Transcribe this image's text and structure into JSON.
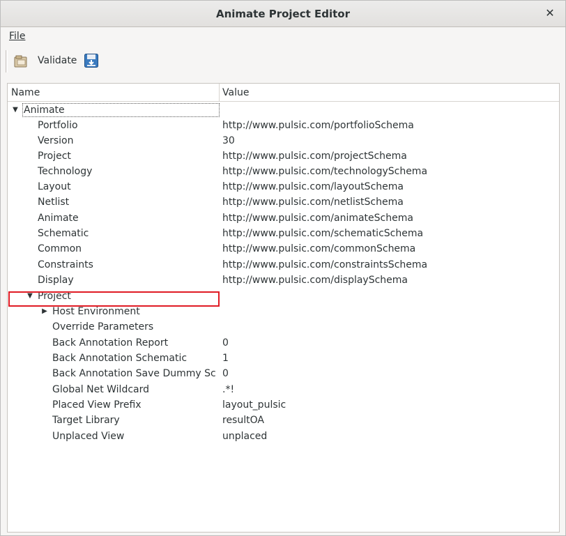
{
  "window": {
    "title": "Animate Project Editor"
  },
  "menu": {
    "file_label": "File"
  },
  "toolbar": {
    "validate_label": "Validate"
  },
  "tree": {
    "columns": {
      "name": "Name",
      "value": "Value"
    },
    "root": {
      "name": "Animate",
      "expanded": true
    },
    "schema_rows": [
      {
        "name": "Portfolio",
        "value": "http://www.pulsic.com/portfolioSchema"
      },
      {
        "name": "Version",
        "value": "30"
      },
      {
        "name": "Project",
        "value": "http://www.pulsic.com/projectSchema"
      },
      {
        "name": "Technology",
        "value": "http://www.pulsic.com/technologySchema"
      },
      {
        "name": "Layout",
        "value": "http://www.pulsic.com/layoutSchema"
      },
      {
        "name": "Netlist",
        "value": "http://www.pulsic.com/netlistSchema"
      },
      {
        "name": "Animate",
        "value": "http://www.pulsic.com/animateSchema"
      },
      {
        "name": "Schematic",
        "value": "http://www.pulsic.com/schematicSchema"
      },
      {
        "name": "Common",
        "value": "http://www.pulsic.com/commonSchema"
      },
      {
        "name": "Constraints",
        "value": "http://www.pulsic.com/constraintsSchema"
      },
      {
        "name": "Display",
        "value": "http://www.pulsic.com/displaySchema"
      }
    ],
    "project_node": {
      "name": "Project",
      "expanded": true
    },
    "project_rows": [
      {
        "name": "Host Environment",
        "value": "",
        "collapsed_arrow": true
      },
      {
        "name": "Override Parameters",
        "value": ""
      },
      {
        "name": "Back Annotation Report",
        "value": "0"
      },
      {
        "name": "Back Annotation Schematic",
        "value": "1"
      },
      {
        "name": "Back Annotation Save Dummy Sch...",
        "value": "0"
      },
      {
        "name": "Global Net Wildcard",
        "value": ".*!"
      },
      {
        "name": "Placed View Prefix",
        "value": "layout_pulsic"
      },
      {
        "name": "Target Library",
        "value": "resultOA"
      },
      {
        "name": "Unplaced View",
        "value": "unplaced"
      }
    ]
  },
  "colors": {
    "highlight": "#e01b24",
    "background": "#f6f5f4"
  }
}
